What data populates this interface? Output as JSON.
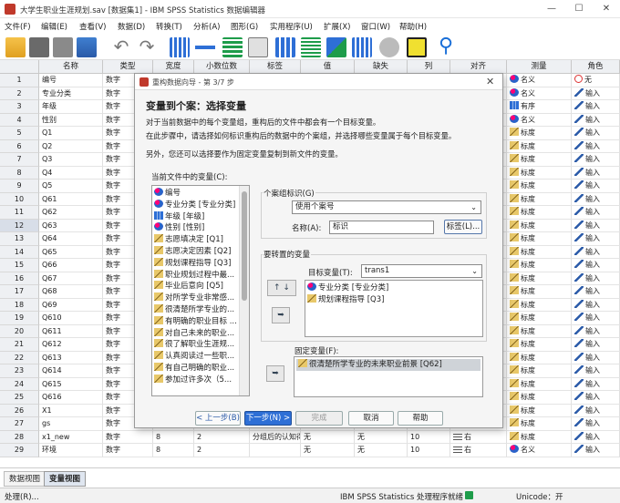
{
  "window": {
    "title": "大学生职业生涯规划.sav [数据集1] - IBM SPSS Statistics 数据编辑器",
    "minimize": "—",
    "maximize": "☐",
    "close": "✕"
  },
  "menu": [
    "文件(F)",
    "编辑(E)",
    "查看(V)",
    "数据(D)",
    "转换(T)",
    "分析(A)",
    "图形(G)",
    "实用程序(U)",
    "扩展(X)",
    "窗口(W)",
    "帮助(H)"
  ],
  "grid": {
    "headers": [
      "名称",
      "类型",
      "宽度",
      "小数位数",
      "标签",
      "值",
      "缺失",
      "列",
      "对齐",
      "测量",
      "角色"
    ],
    "rows": [
      [
        "1",
        "编号",
        "数字",
        "",
        "",
        "",
        "",
        "",
        "",
        "",
        "名义",
        "无"
      ],
      [
        "2",
        "专业分类",
        "数字",
        "",
        "",
        "",
        "",
        "",
        "",
        "",
        "名义",
        "输入"
      ],
      [
        "3",
        "年级",
        "数字",
        "",
        "",
        "",
        "",
        "",
        "",
        "",
        "有序",
        "输入"
      ],
      [
        "4",
        "性别",
        "数字",
        "",
        "",
        "",
        "",
        "",
        "",
        "",
        "名义",
        "输入"
      ],
      [
        "5",
        "Q1",
        "数字",
        "",
        "",
        "",
        "",
        "",
        "",
        "",
        "标度",
        "输入"
      ],
      [
        "6",
        "Q2",
        "数字",
        "",
        "",
        "",
        "",
        "",
        "",
        "",
        "标度",
        "输入"
      ],
      [
        "7",
        "Q3",
        "数字",
        "",
        "",
        "",
        "",
        "",
        "",
        "",
        "标度",
        "输入"
      ],
      [
        "8",
        "Q4",
        "数字",
        "",
        "",
        "",
        "",
        "",
        "",
        "",
        "标度",
        "输入"
      ],
      [
        "9",
        "Q5",
        "数字",
        "",
        "",
        "",
        "",
        "",
        "",
        "",
        "标度",
        "输入"
      ],
      [
        "10",
        "Q61",
        "数字",
        "",
        "",
        "",
        "",
        "",
        "",
        "",
        "标度",
        "输入"
      ],
      [
        "11",
        "Q62",
        "数字",
        "",
        "",
        "",
        "",
        "",
        "",
        "",
        "标度",
        "输入"
      ],
      [
        "12",
        "Q63",
        "数字",
        "",
        "",
        "",
        "",
        "",
        "",
        "",
        "标度",
        "输入"
      ],
      [
        "13",
        "Q64",
        "数字",
        "",
        "",
        "",
        "",
        "",
        "",
        "",
        "标度",
        "输入"
      ],
      [
        "14",
        "Q65",
        "数字",
        "",
        "",
        "",
        "",
        "",
        "",
        "",
        "标度",
        "输入"
      ],
      [
        "15",
        "Q66",
        "数字",
        "",
        "",
        "",
        "",
        "",
        "",
        "",
        "标度",
        "输入"
      ],
      [
        "16",
        "Q67",
        "数字",
        "",
        "",
        "",
        "",
        "",
        "",
        "",
        "标度",
        "输入"
      ],
      [
        "17",
        "Q68",
        "数字",
        "",
        "",
        "",
        "",
        "",
        "",
        "",
        "标度",
        "输入"
      ],
      [
        "18",
        "Q69",
        "数字",
        "",
        "",
        "",
        "",
        "",
        "",
        "",
        "标度",
        "输入"
      ],
      [
        "19",
        "Q610",
        "数字",
        "",
        "",
        "",
        "",
        "",
        "",
        "",
        "标度",
        "输入"
      ],
      [
        "20",
        "Q611",
        "数字",
        "",
        "",
        "",
        "",
        "",
        "",
        "",
        "标度",
        "输入"
      ],
      [
        "21",
        "Q612",
        "数字",
        "",
        "",
        "",
        "",
        "",
        "",
        "",
        "标度",
        "输入"
      ],
      [
        "22",
        "Q613",
        "数字",
        "",
        "",
        "",
        "",
        "",
        "",
        "",
        "标度",
        "输入"
      ],
      [
        "23",
        "Q614",
        "数字",
        "",
        "",
        "",
        "",
        "",
        "",
        "",
        "标度",
        "输入"
      ],
      [
        "24",
        "Q615",
        "数字",
        "",
        "",
        "",
        "",
        "",
        "",
        "",
        "标度",
        "输入"
      ],
      [
        "25",
        "Q616",
        "数字",
        "",
        "",
        "",
        "",
        "",
        "",
        "",
        "标度",
        "输入"
      ],
      [
        "26",
        "X1",
        "数字",
        "",
        "",
        "",
        "",
        "",
        "",
        "",
        "标度",
        "输入"
      ],
      [
        "27",
        "gs",
        "数字",
        "",
        "",
        "",
        "",
        "",
        "",
        "",
        "标度",
        "输入"
      ],
      [
        "28",
        "x1_new",
        "数字",
        "8",
        "2",
        "分组后的认知得...",
        "无",
        "无",
        "10",
        "右",
        "标度",
        "输入"
      ],
      [
        "29",
        "环境",
        "数字",
        "8",
        "2",
        "",
        "无",
        "无",
        "10",
        "右",
        "名义",
        "输入"
      ]
    ]
  },
  "tabs": [
    "数据视图",
    "变量视图"
  ],
  "status": {
    "left": "处理(R)...",
    "center": "IBM SPSS Statistics 处理程序就绪",
    "unicode": "Unicode：开"
  },
  "dialog": {
    "title": "重构数据向导 - 第 3/7 步",
    "heading": "变量到个案：选择变量",
    "desc1": "对于当前数据中的每个变量组，重构后的文件中都会有一个目标变量。",
    "desc2": "在此步骤中，请选择如何标识重构后的数据中的个案组，并选择哪些变量属于每个目标变量。",
    "desc3": "另外，您还可以选择要作为固定变量复制到新文件的变量。",
    "current_vars_label": "当前文件中的变量(C):",
    "current_vars": [
      "编号",
      "专业分类 [专业分类]",
      "年级 [年级]",
      "性别 [性别]",
      "志愿填决定 [Q1]",
      "志愿决定因素 [Q2]",
      "规划课程指导 [Q3]",
      "职业规划过程中最...",
      "毕业后意向 [Q5]",
      "对所学专业非常感...",
      "很清楚所学专业的...",
      "有明确的职业目标 ...",
      "对自己未来的职业...",
      "很了解职业生涯规...",
      "认真阅读过一些职...",
      "有自己明确的职业...",
      "参加过许多次（5..."
    ],
    "case_group_label": "个案组标识(G)",
    "case_group_value": "使用个案号",
    "name_label": "名称(A):",
    "name_value": "标识",
    "label_button": "标签(L)...",
    "transpose_label": "要转置的变量",
    "target_label": "目标变量(T):",
    "target_value": "trans1",
    "transpose_vars": [
      "专业分类 [专业分类]",
      "规划课程指导 [Q3]"
    ],
    "fixed_label": "固定变量(F):",
    "fixed_vars": [
      "很清楚所学专业的未来职业前景 [Q62]"
    ],
    "buttons": {
      "back": "< 上一步(B)",
      "next": "下一步(N) >",
      "finish": "完成",
      "cancel": "取消",
      "help": "帮助"
    }
  }
}
